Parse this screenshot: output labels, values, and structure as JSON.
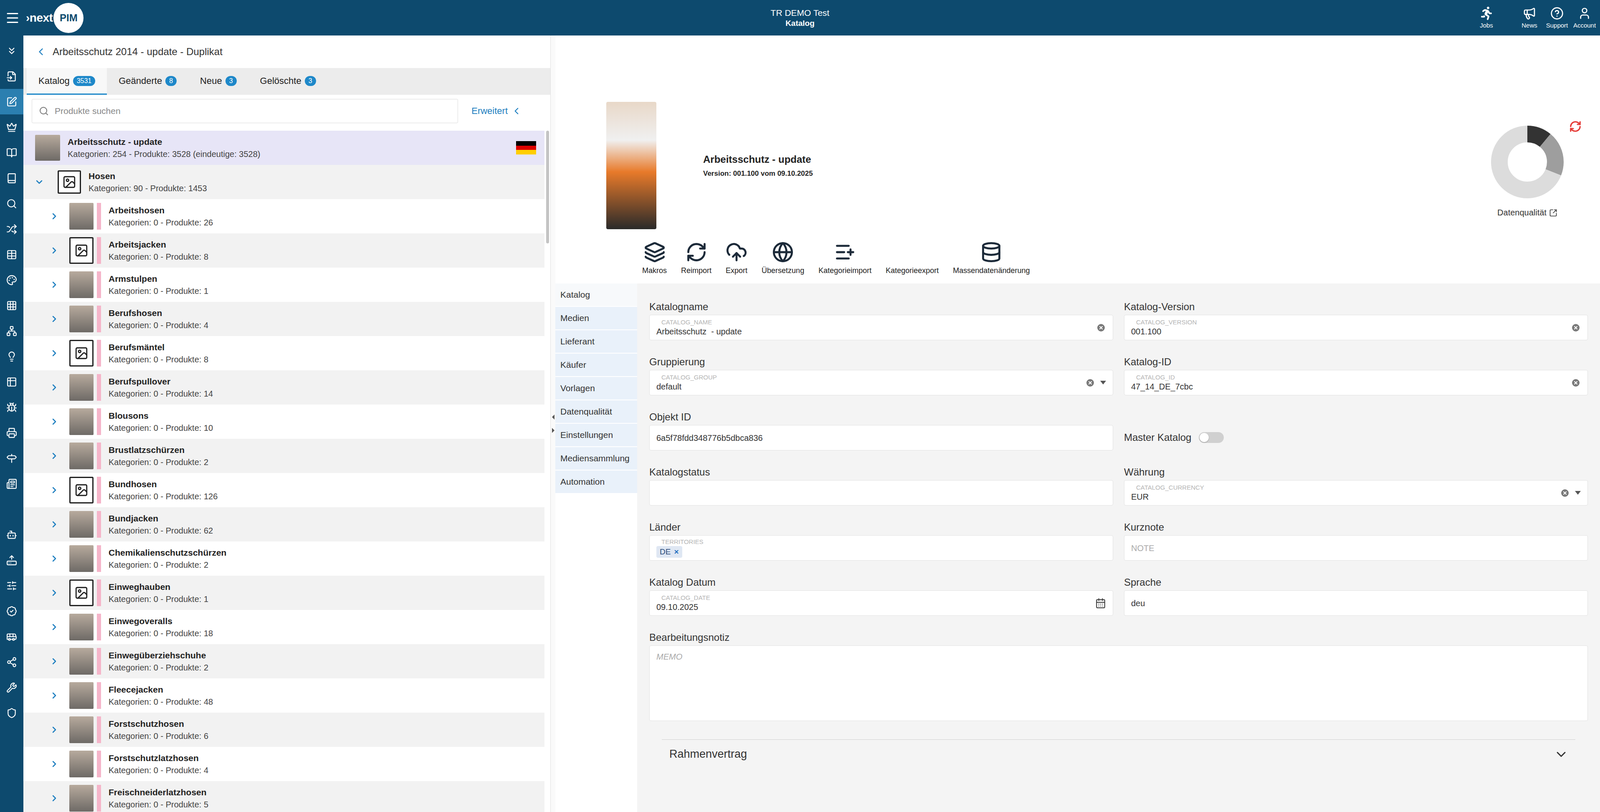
{
  "topbar": {
    "logo": {
      "prefix": "›next",
      "badge": "PIM"
    },
    "title": "TR DEMO Test",
    "subtitle": "Katalog",
    "actions": [
      {
        "label": "Jobs"
      },
      {
        "label": "News"
      },
      {
        "label": "Support"
      },
      {
        "label": "Account"
      }
    ]
  },
  "sidebar": {
    "items": [
      {
        "selected": false
      },
      {
        "selected": false
      },
      {
        "selected": true
      },
      {
        "selected": false
      },
      {
        "selected": false
      },
      {
        "selected": false
      },
      {
        "selected": false
      },
      {
        "selected": false
      },
      {
        "selected": false
      },
      {
        "selected": false
      },
      {
        "selected": false
      },
      {
        "selected": false
      },
      {
        "selected": false
      },
      {
        "selected": false
      },
      {
        "selected": false
      },
      {
        "selected": false
      },
      {
        "selected": false
      },
      {
        "selected": false
      },
      {
        "selected": false
      },
      {
        "selected": false
      },
      {
        "selected": false
      },
      {
        "selected": false
      },
      {
        "selected": false
      },
      {
        "selected": false
      },
      {
        "selected": false
      },
      {
        "selected": false
      },
      {
        "selected": false
      }
    ]
  },
  "catalog_panel": {
    "title": "Arbeitsschutz 2014 - update - Duplikat",
    "tabs": [
      {
        "label": "Katalog",
        "count": "3531",
        "selected": true
      },
      {
        "label": "Geänderte",
        "count": "8",
        "selected": false
      },
      {
        "label": "Neue",
        "count": "3",
        "selected": false
      },
      {
        "label": "Gelöschte",
        "count": "3",
        "selected": false
      }
    ],
    "search": {
      "placeholder": "Produkte suchen",
      "advanced": "Erweitert"
    },
    "root": {
      "title": "Arbeitsschutz - update",
      "subtitle": "Kategorien: 254 - Produkte: 3528 (eindeutige: 3528)",
      "selected": true
    },
    "tree": [
      {
        "title": "Hosen",
        "subtitle": "Kategorien: 90 - Produkte: 1453",
        "expanded": true,
        "has_image": false,
        "children": [
          {
            "title": "Arbeitshosen",
            "subtitle": "Kategorien: 0 - Produkte: 26",
            "expanded": false,
            "has_image": true
          },
          {
            "title": "Arbeitsjacken",
            "subtitle": "Kategorien: 0 - Produkte: 8",
            "expanded": false,
            "has_image": false
          },
          {
            "title": "Armstulpen",
            "subtitle": "Kategorien: 0 - Produkte: 1",
            "expanded": false,
            "has_image": true
          },
          {
            "title": "Berufshosen",
            "subtitle": "Kategorien: 0 - Produkte: 4",
            "expanded": false,
            "has_image": true
          },
          {
            "title": "Berufsmäntel",
            "subtitle": "Kategorien: 0 - Produkte: 8",
            "expanded": false,
            "has_image": false
          },
          {
            "title": "Berufspullover",
            "subtitle": "Kategorien: 0 - Produkte: 14",
            "expanded": false,
            "has_image": true
          },
          {
            "title": "Blousons",
            "subtitle": "Kategorien: 0 - Produkte: 10",
            "expanded": false,
            "has_image": true
          },
          {
            "title": "Brustlatzschürzen",
            "subtitle": "Kategorien: 0 - Produkte: 2",
            "expanded": false,
            "has_image": true
          },
          {
            "title": "Bundhosen",
            "subtitle": "Kategorien: 0 - Produkte: 126",
            "expanded": false,
            "has_image": false
          },
          {
            "title": "Bundjacken",
            "subtitle": "Kategorien: 0 - Produkte: 62",
            "expanded": false,
            "has_image": true
          },
          {
            "title": "Chemikalienschutzschürzen",
            "subtitle": "Kategorien: 0 - Produkte: 2",
            "expanded": false,
            "has_image": true
          },
          {
            "title": "Einweghauben",
            "subtitle": "Kategorien: 0 - Produkte: 1",
            "expanded": false,
            "has_image": false
          },
          {
            "title": "Einwegoveralls",
            "subtitle": "Kategorien: 0 - Produkte: 18",
            "expanded": false,
            "has_image": true
          },
          {
            "title": "Einwegüberziehschuhe",
            "subtitle": "Kategorien: 0 - Produkte: 2",
            "expanded": false,
            "has_image": true
          },
          {
            "title": "Fleecejacken",
            "subtitle": "Kategorien: 0 - Produkte: 48",
            "expanded": false,
            "has_image": true
          },
          {
            "title": "Forstschutzhosen",
            "subtitle": "Kategorien: 0 - Produkte: 6",
            "expanded": false,
            "has_image": true
          },
          {
            "title": "Forstschutzlatzhosen",
            "subtitle": "Kategorien: 0 - Produkte: 4",
            "expanded": false,
            "has_image": true
          },
          {
            "title": "Freischneiderlatzhosen",
            "subtitle": "Kategorien: 0 - Produkte: 5",
            "expanded": false,
            "has_image": true
          }
        ]
      }
    ]
  },
  "detail": {
    "header": {
      "title": "Arbeitsschutz - update",
      "version": "Version: 001.100 vom 09.10.2025"
    },
    "data_quality": {
      "label": "Datenqualität",
      "segments": [
        {
          "value": 0.11,
          "color": "#333333"
        },
        {
          "value": 0.2,
          "color": "#9e9e9e"
        },
        {
          "value": 0.69,
          "color": "#dcdcdc"
        }
      ]
    },
    "toolbar": [
      {
        "label": "Makros"
      },
      {
        "label": "Reimport"
      },
      {
        "label": "Export"
      },
      {
        "label": "Übersetzung"
      },
      {
        "label": "Kategorieimport"
      },
      {
        "label": "Kategorieexport"
      },
      {
        "label": "Massendatenänderung"
      }
    ],
    "nav": [
      {
        "label": "Katalog",
        "selected": true
      },
      {
        "label": "Medien",
        "selected": false
      },
      {
        "label": "Lieferant",
        "selected": false
      },
      {
        "label": "Käufer",
        "selected": false
      },
      {
        "label": "Vorlagen",
        "selected": false
      },
      {
        "label": "Datenqualität",
        "selected": false
      },
      {
        "label": "Einstellungen",
        "selected": false
      },
      {
        "label": "Mediensammlung",
        "selected": false
      },
      {
        "label": "Automation",
        "selected": false
      }
    ],
    "fields": [
      {
        "kind": "text",
        "label": "Katalogname",
        "hint": "CATALOG_NAME",
        "value": "Arbeitsschutz  - update",
        "placeholder": "",
        "clearable": true,
        "dropdown": false
      },
      {
        "kind": "text",
        "label": "Katalog-Version",
        "hint": "CATALOG_VERSION",
        "value": "001.100",
        "placeholder": "",
        "clearable": true,
        "dropdown": false
      },
      {
        "kind": "text",
        "label": "Gruppierung",
        "hint": "CATALOG_GROUP",
        "value": "default",
        "placeholder": "",
        "clearable": true,
        "dropdown": true
      },
      {
        "kind": "text",
        "label": "Katalog-ID",
        "hint": "CATALOG_ID",
        "value": "47_14_DE_7cbc",
        "placeholder": "",
        "clearable": true,
        "dropdown": false
      },
      {
        "kind": "text",
        "label": "Objekt ID",
        "hint": "",
        "value": "6a5f78fdd348776b5dbca836",
        "placeholder": "",
        "clearable": false,
        "dropdown": false
      },
      {
        "kind": "toggle",
        "label": "Master Katalog",
        "on": false
      },
      {
        "kind": "text",
        "label": "Katalogstatus",
        "hint": "",
        "value": "",
        "placeholder": "",
        "clearable": false,
        "dropdown": false
      },
      {
        "kind": "text",
        "label": "Währung",
        "hint": "CATALOG_CURRENCY",
        "value": "EUR",
        "placeholder": "",
        "clearable": true,
        "dropdown": true
      },
      {
        "kind": "chips",
        "label": "Länder",
        "hint": "TERRITORIES",
        "chips": [
          {
            "label": "DE",
            "remove": "×"
          }
        ]
      },
      {
        "kind": "text",
        "label": "Kurznote",
        "hint": "",
        "value": "",
        "placeholder": "NOTE",
        "clearable": false,
        "dropdown": false
      },
      {
        "kind": "date",
        "label": "Katalog Datum",
        "hint": "CATALOG_DATE",
        "value": "09.10.2025"
      },
      {
        "kind": "text",
        "label": "Sprache",
        "hint": "",
        "value": "deu",
        "placeholder": "",
        "clearable": false,
        "dropdown": false
      }
    ],
    "memo": {
      "label": "Bearbeitungsnotiz",
      "placeholder": "MEMO"
    },
    "accordion": {
      "label": "Rahmenvertrag",
      "expanded": false
    }
  }
}
